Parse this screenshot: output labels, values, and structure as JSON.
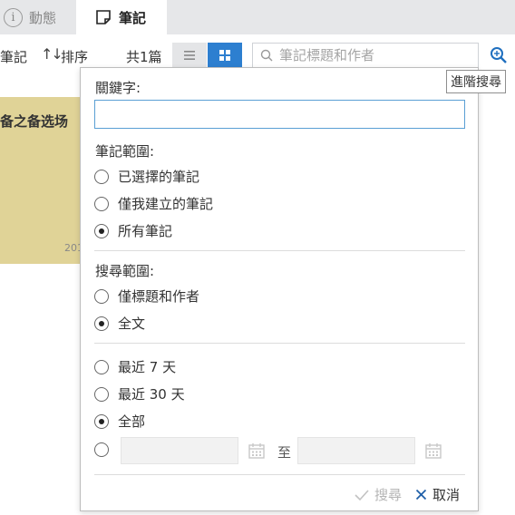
{
  "tabs": {
    "activity_label": "動態",
    "notes_label": "筆記"
  },
  "toolbar": {
    "notes_label": "筆記",
    "sort_label": "排序",
    "count_label": "共1篇",
    "search_placeholder": "筆記標題和作者",
    "advanced_search_tooltip": "進階搜尋"
  },
  "note_card": {
    "title": "备之备选场",
    "date_fragment": "201"
  },
  "popup": {
    "keyword_label": "關鍵字:",
    "keyword_value": "",
    "note_scope": {
      "label": "筆記範圍:",
      "options": [
        "已選擇的筆記",
        "僅我建立的筆記",
        "所有筆記"
      ],
      "selected": "所有筆記"
    },
    "search_scope": {
      "label": "搜尋範圍:",
      "options": [
        "僅標題和作者",
        "全文"
      ],
      "selected": "全文"
    },
    "time_range": {
      "options": [
        "最近 7 天",
        "最近 30 天",
        "全部"
      ],
      "selected": "全部"
    },
    "date_range": {
      "from_value": "",
      "to_label": "至",
      "to_value": ""
    },
    "search_button": "搜尋",
    "cancel_button": "取消"
  },
  "colors": {
    "accent": "#2d7fd0",
    "tab_bar": "#e6e7e9",
    "note_card": "#e0d397",
    "disabled_text": "#b5b5b5"
  }
}
